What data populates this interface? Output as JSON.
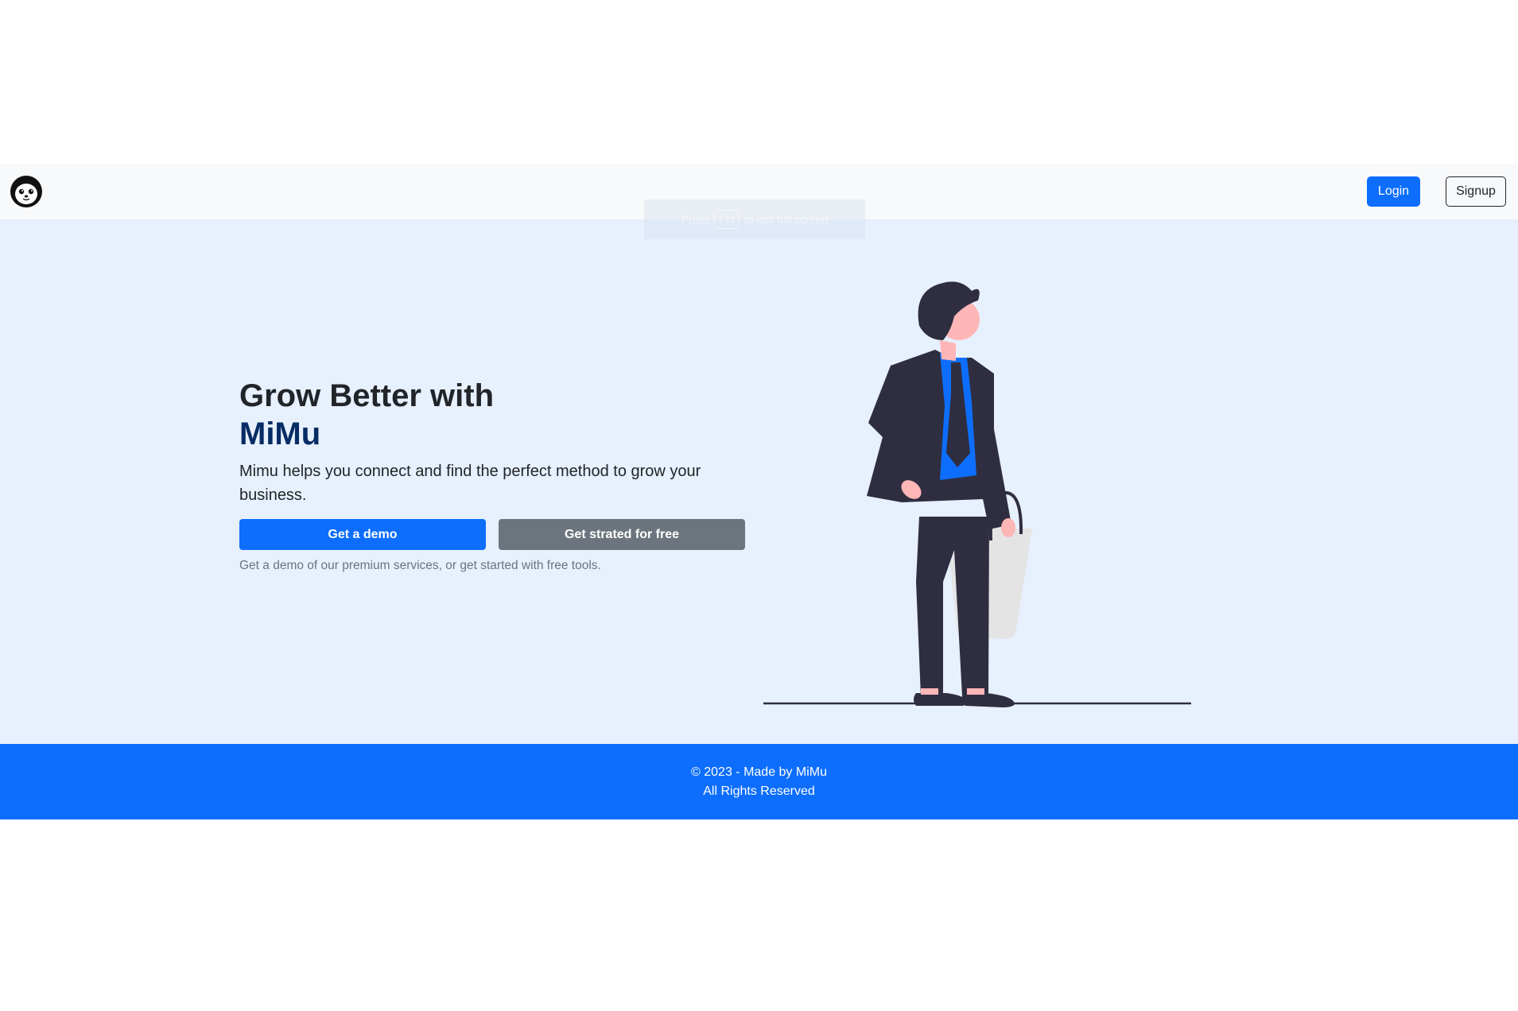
{
  "navbar": {
    "logo_icon": "cat-face-icon",
    "login_label": "Login",
    "signup_label": "Signup"
  },
  "fullscreen_toast": {
    "prefix": "Press",
    "key": "F11",
    "suffix": "to exit full screen"
  },
  "hero": {
    "title_line1": "Grow Better with",
    "title_brand": "MiMu",
    "description": "Mimu helps you connect and find the perfect method to grow your business.",
    "demo_button_label": "Get a demo",
    "free_button_label": "Get strated for free",
    "note": "Get a demo of our premium services, or get started with free tools.",
    "illustration_icon": "businessman-with-bag-illustration"
  },
  "footer": {
    "copyright": "© 2023 - Made by MiMu",
    "rights": "All Rights Reserved"
  },
  "colors": {
    "primary": "#0d6efd",
    "secondary": "#6c757d",
    "hero_bg": "#e7f0fd",
    "navbar_bg": "#f8f9fa",
    "brand_text": "#052c65",
    "figure_dark": "#2f2e41",
    "skin": "#ffb6b6"
  }
}
